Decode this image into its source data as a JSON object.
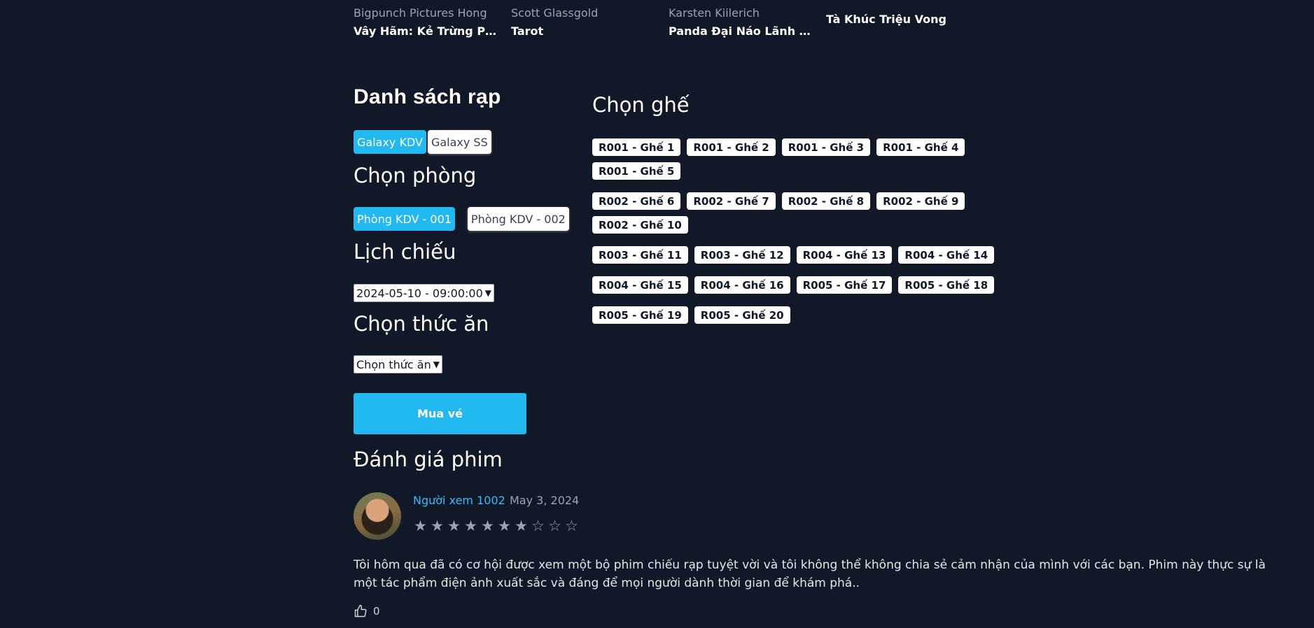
{
  "related_movies": [
    {
      "studio": "Bigpunch Pictures Hong",
      "title": "Vây Hãm: Kẻ Trừng Phạt"
    },
    {
      "studio": "Scott Glassgold",
      "title": "Tarot"
    },
    {
      "studio": "Karsten Kiilerich",
      "title": "Panda Đại Náo Lãnh Địa..."
    },
    {
      "studio": "",
      "title": "Tà Khúc Triệu Vong"
    }
  ],
  "cinemas": {
    "heading": "Danh sách rạp",
    "items": [
      "Galaxy KDV",
      "Galaxy SS"
    ]
  },
  "rooms": {
    "heading": "Chọn phòng",
    "items": [
      "Phòng KDV - 001",
      "Phòng KDV - 002"
    ]
  },
  "showtime": {
    "heading": "Lịch chiếu",
    "selected": "2024-05-10 - 09:00:00"
  },
  "food": {
    "heading": "Chọn thức ăn",
    "selected": "Chọn thức ăn"
  },
  "buy_button": "Mua vé",
  "seats": {
    "heading": "Chọn ghế",
    "items": [
      "R001 - Ghế 1",
      "R001 - Ghế 2",
      "R001 - Ghế 3",
      "R001 - Ghế 4",
      "R001 - Ghế 5",
      "R002 - Ghế 6",
      "R002 - Ghế 7",
      "R002 - Ghế 8",
      "R002 - Ghế 9",
      "R002 - Ghế 10",
      "R003 - Ghế 11",
      "R003 - Ghế 12",
      "R004 - Ghế 13",
      "R004 - Ghế 14",
      "R004 - Ghế 15",
      "R004 - Ghế 16",
      "R005 - Ghế 17",
      "R005 - Ghế 18",
      "R005 - Ghế 19",
      "R005 - Ghế 20"
    ]
  },
  "reviews": {
    "heading": "Đánh giá phim",
    "items": [
      {
        "author": "Người xem 1002",
        "date": "May 3, 2024",
        "rating": 7,
        "max_rating": 10,
        "text": "Tôi hôm qua đã có cơ hội được xem một bộ phim chiếu rạp tuyệt vời và tôi không thể không chia sẻ cảm nhận của mình với các bạn. Phim này thực sự là một tác phẩm điện ảnh xuất sắc và đáng để mọi người dành thời gian để khám phá..",
        "likes": "0"
      }
    ]
  },
  "colors": {
    "background": "#111827",
    "accent": "#22b8f0",
    "link": "#38bdf8",
    "muted": "#9ca3af"
  }
}
